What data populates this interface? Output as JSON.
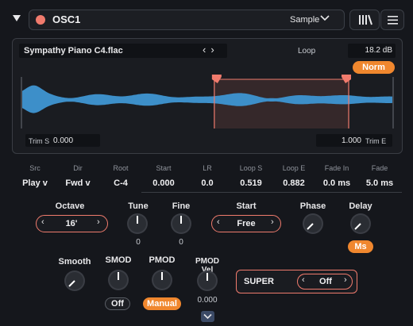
{
  "header": {
    "title": "OSC1",
    "mode": "Sample",
    "color": "#f07b6d"
  },
  "waveform": {
    "file_name": "Sympathy Piano C4.flac",
    "loop_label": "Loop",
    "gain": "18.2 dB",
    "norm_label": "Norm",
    "trim_s_label": "Trim S",
    "trim_s_value": "0.000",
    "trim_e_label": "Trim E",
    "trim_e_value": "1.000",
    "loop_start": 0.519,
    "loop_end": 0.882
  },
  "params": [
    {
      "label": "Src",
      "value": "Play v"
    },
    {
      "label": "Dir",
      "value": "Fwd v"
    },
    {
      "label": "Root",
      "value": "C-4"
    },
    {
      "label": "Start",
      "value": "0.000"
    },
    {
      "label": "LR",
      "value": "0.0"
    },
    {
      "label": "Loop S",
      "value": "0.519"
    },
    {
      "label": "Loop E",
      "value": "0.882"
    },
    {
      "label": "Fade In",
      "value": "0.0 ms"
    },
    {
      "label": "Fade",
      "value": "5.0 ms"
    }
  ],
  "controls": {
    "octave_label": "Octave",
    "octave_value": "16'",
    "tune_label": "Tune",
    "tune_value": "0",
    "fine_label": "Fine",
    "fine_value": "0",
    "start_label": "Start",
    "start_value": "Free",
    "phase_label": "Phase",
    "delay_label": "Delay",
    "delay_unit": "Ms",
    "smooth_label": "Smooth",
    "smod_label": "SMOD",
    "smod_value": "Off",
    "pmod_label": "PMOD",
    "pmod_value": "Manual",
    "pmod_vel_label": "PMOD Vel",
    "pmod_vel_value": "0.000",
    "super_label": "SUPER",
    "super_value": "Off"
  },
  "colors": {
    "accent": "#f0872e",
    "outline": "#f07b6d",
    "wave": "#3d8fc9"
  },
  "icons": {
    "collapse": "triangle-down-icon",
    "mode_dropdown": "chevron-down-icon",
    "bars": "library-bars-icon",
    "menu": "hamburger-icon",
    "expand": "chevron-down-icon"
  }
}
